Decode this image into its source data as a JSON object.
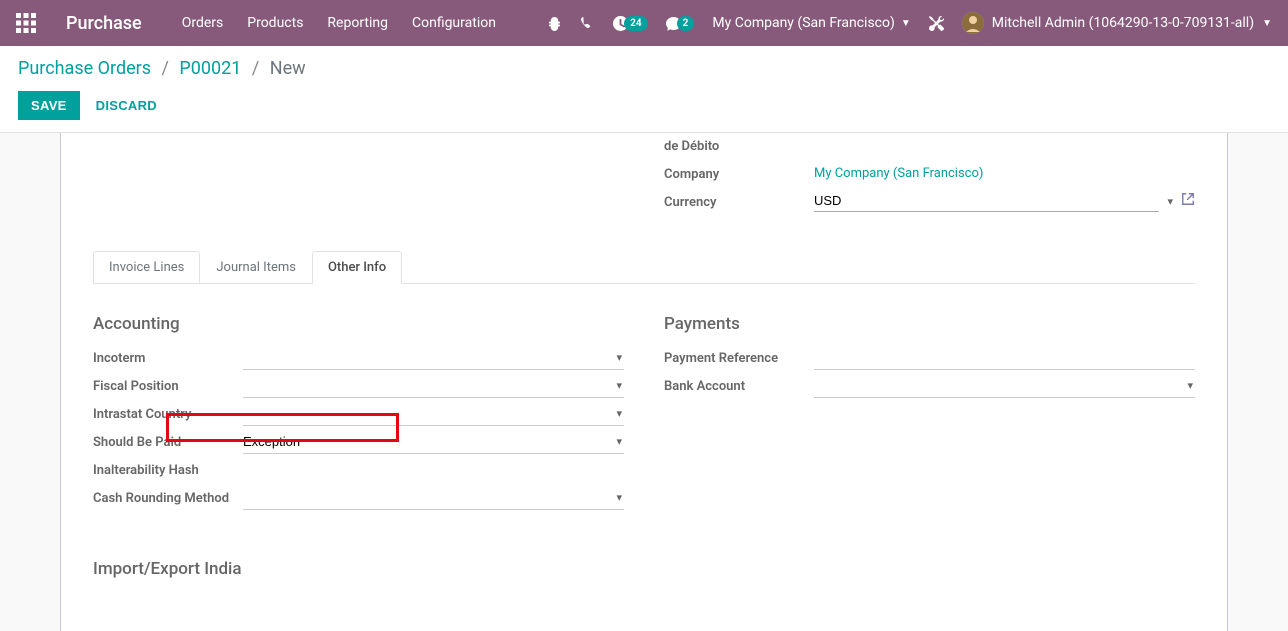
{
  "nav": {
    "brand": "Purchase",
    "menu": [
      "Orders",
      "Products",
      "Reporting",
      "Configuration"
    ],
    "activities_badge": "24",
    "messages_badge": "2",
    "company": "My Company (San Francisco)",
    "user": "Mitchell Admin (1064290-13-0-709131-all)"
  },
  "breadcrumb": {
    "root": "Purchase Orders",
    "mid": "P00021",
    "current": "New"
  },
  "actions": {
    "save": "SAVE",
    "discard": "DISCARD"
  },
  "top_fields": {
    "de_debito_label": "de Débito",
    "company_label": "Company",
    "company_value": "My Company (San Francisco)",
    "currency_label": "Currency",
    "currency_value": "USD"
  },
  "tabs": {
    "invoice_lines": "Invoice Lines",
    "journal_items": "Journal Items",
    "other_info": "Other Info"
  },
  "accounting": {
    "title": "Accounting",
    "incoterm_label": "Incoterm",
    "incoterm_value": "",
    "fiscal_position_label": "Fiscal Position",
    "fiscal_position_value": "",
    "intrastat_country_label": "Intrastat Country",
    "intrastat_country_value": "",
    "should_be_paid_label": "Should Be Paid",
    "should_be_paid_value": "Exception",
    "inalterability_hash_label": "Inalterability Hash",
    "inalterability_hash_value": "",
    "cash_rounding_label": "Cash Rounding Method",
    "cash_rounding_value": ""
  },
  "payments": {
    "title": "Payments",
    "payment_reference_label": "Payment Reference",
    "payment_reference_value": "",
    "bank_account_label": "Bank Account",
    "bank_account_value": ""
  },
  "import_export": {
    "title": "Import/Export India"
  }
}
